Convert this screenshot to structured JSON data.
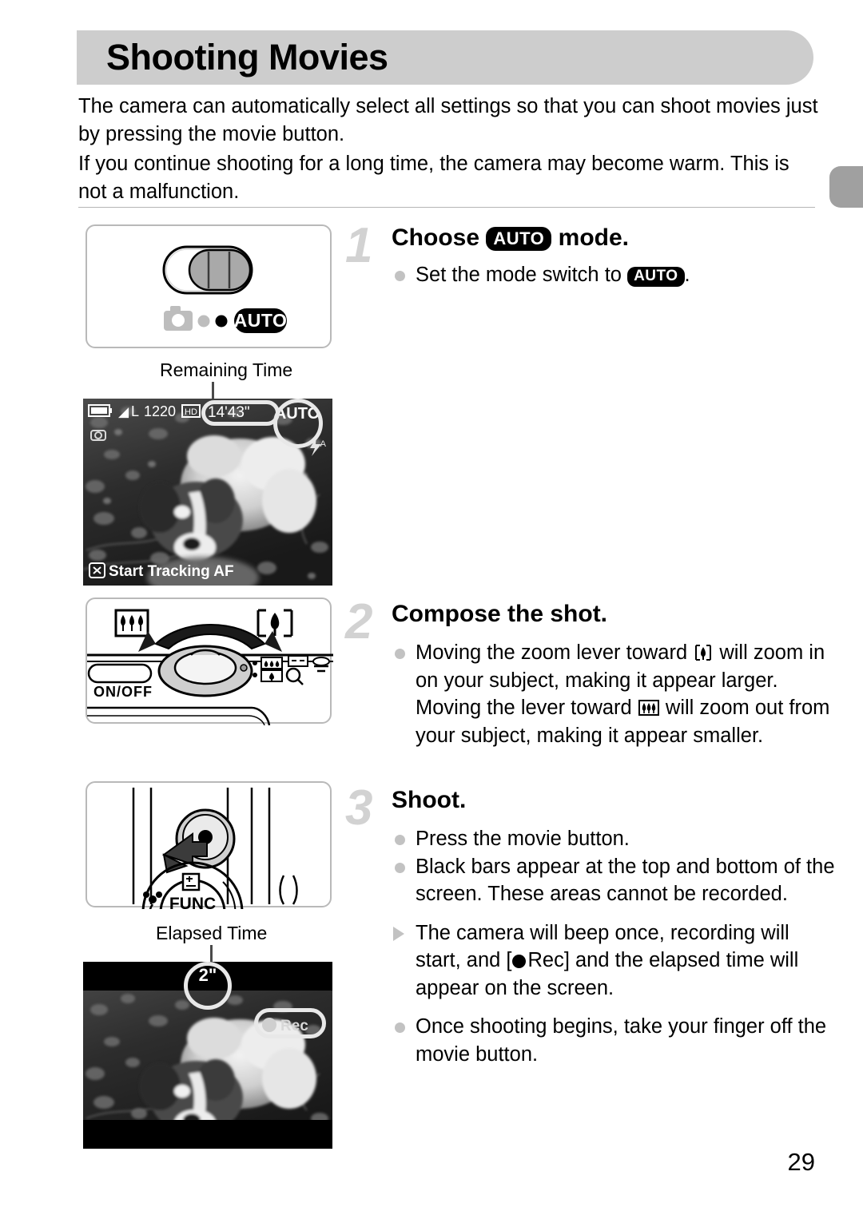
{
  "page": {
    "title": "Shooting Movies",
    "number": "29",
    "edge_tab": "section-tab"
  },
  "intro": {
    "paragraph1": "The camera can automatically select all settings so that you can shoot movies just by pressing the movie button.",
    "paragraph2": "If you continue shooting for a long time, the camera may become warm. This is not a malfunction."
  },
  "steps": [
    {
      "number": "1",
      "heading_before": "Choose",
      "heading_badge": "AUTO",
      "heading_after": "mode.",
      "bullets": [
        {
          "type": "dot",
          "text_before": "Set the mode switch to",
          "badge": "AUTO",
          "text_after": "."
        }
      ]
    },
    {
      "number": "2",
      "heading": "Compose the shot.",
      "bullets": [
        {
          "type": "dot",
          "part1": "Moving the zoom lever toward",
          "icon1": "telephoto-icon",
          "part2": "will zoom in on your subject, making it appear larger. Moving the lever toward",
          "icon2": "wide-angle-icon",
          "part3": "will zoom out from your subject, making it appear smaller."
        }
      ]
    },
    {
      "number": "3",
      "heading": "Shoot.",
      "bullets": [
        {
          "type": "dot",
          "text": "Press the movie button."
        },
        {
          "type": "dot",
          "text": "Black bars appear at the top and bottom of the screen. These areas cannot be recorded."
        },
        {
          "type": "triangle",
          "part1": "The camera will beep once, recording will start, and [",
          "icon": "rec-dot-icon",
          "part2": "Rec] and the elapsed time will appear on the screen."
        },
        {
          "type": "dot",
          "text": "Once shooting begins, take your finger off the movie button."
        }
      ]
    }
  ],
  "figures": {
    "mode_switch": {
      "name": "mode-switch-diagram",
      "badge": "AUTO",
      "icons": [
        "camera-icon",
        "dot-gray-icon",
        "dot-black-icon",
        "auto-badge-icon"
      ]
    },
    "zoom_lever": {
      "name": "zoom-lever-diagram",
      "power_label": "ON/OFF",
      "wide_icon": "wide-angle-icon",
      "tele_icon": "telephoto-icon"
    },
    "movie_button": {
      "name": "movie-button-diagram",
      "func_label": "FUNC",
      "exposure_icon": "exposure-compensation-icon",
      "macro_icon": "macro-flower-icon"
    }
  },
  "screens": {
    "remaining": {
      "callout": "Remaining Time",
      "battery_icon": "battery-icon",
      "quality": "L",
      "shots": "1220",
      "movie_quality_icon": "movie-quality-icon",
      "time": "14'43\"",
      "mode_badge": "AUTO",
      "flash_icon": "flash-auto-icon",
      "af_icon": "tracking-af-icon",
      "af_label": "Start Tracking AF"
    },
    "elapsed": {
      "callout": "Elapsed Time",
      "time": "2\"",
      "rec_icon": "rec-dot-icon",
      "rec_label": "Rec"
    }
  },
  "colors": {
    "header_bg": "#cdcdcd",
    "step_number": "#d2d2d2",
    "bullet_dot": "#c2c2c2",
    "frame_border": "#b9b9b9",
    "edge_tab": "#a0a0a0"
  }
}
